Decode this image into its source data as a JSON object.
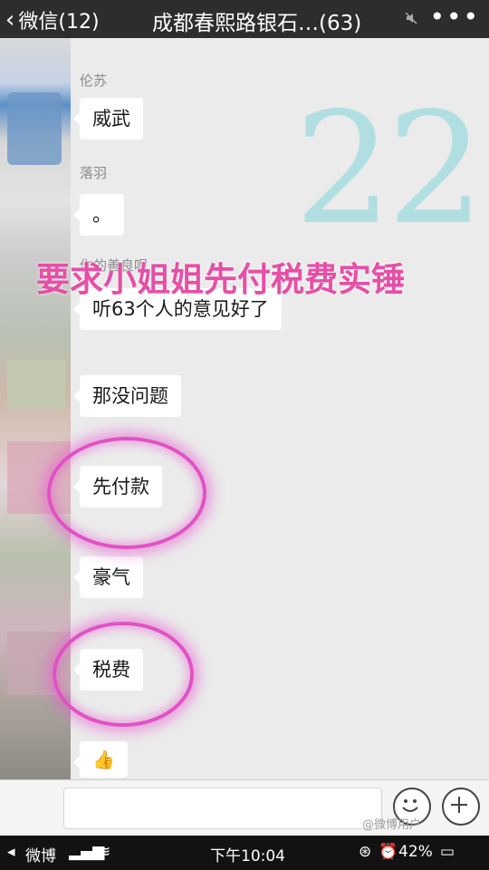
{
  "topbar": {
    "back_label": "微信(12)",
    "title": "成都春熙路银石…(63)",
    "more_icon": "more-icon",
    "mute_icon": "mute-icon"
  },
  "chat": {
    "messages": [
      {
        "sender": "伦苏",
        "text": "威武"
      },
      {
        "sender": "落羽",
        "text": "。"
      },
      {
        "sender": "你的善良呢",
        "text": "听63个人的意见好了"
      },
      {
        "sender": "",
        "text": "那没问题"
      },
      {
        "sender": "",
        "text": "先付款"
      },
      {
        "sender": "",
        "text": "豪气"
      },
      {
        "sender": "",
        "text": "税费"
      },
      {
        "sender": "",
        "text": "👍"
      }
    ],
    "big_number": "22",
    "overlay_text": "要求小姐姐先付税费实锤"
  },
  "inputbar": {
    "emoji_icon": "emoji-icon",
    "plus_icon": "plus-icon",
    "watermark": "@微博用户"
  },
  "statusbar": {
    "carrier": "微博",
    "time": "下午10:04",
    "battery": "42%"
  },
  "colors": {
    "header_bg": "#2d2d2f",
    "chat_bg": "#ebebeb",
    "overlay_pink": "#e64fa6",
    "number_teal": "#a8dde0"
  }
}
